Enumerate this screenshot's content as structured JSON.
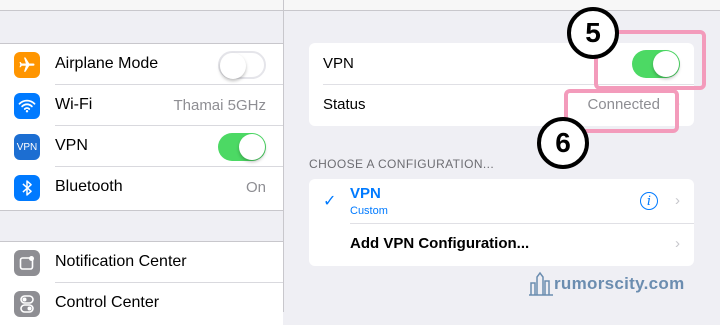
{
  "sidebar": {
    "items": [
      {
        "label": "Airplane Mode",
        "icon": "airplane-icon",
        "icon_color": "#ff9500",
        "control": "switch",
        "switch_on": false
      },
      {
        "label": "Wi-Fi",
        "icon": "wifi-icon",
        "icon_color": "#007aff",
        "value": "Thamai 5GHz"
      },
      {
        "label": "VPN",
        "icon": "vpn-icon",
        "icon_glyph": "VPN",
        "icon_color": "#1c6ed2",
        "control": "switch",
        "switch_on": true
      },
      {
        "label": "Bluetooth",
        "icon": "bluetooth-icon",
        "icon_color": "#007aff",
        "value": "On"
      }
    ],
    "items2": [
      {
        "label": "Notification Center",
        "icon": "notification-center-icon",
        "icon_color": "#8e8e93"
      },
      {
        "label": "Control Center",
        "icon": "control-center-icon",
        "icon_color": "#8e8e93"
      }
    ]
  },
  "vpn_panel": {
    "vpn_label": "VPN",
    "vpn_switch_on": true,
    "status_label": "Status",
    "status_value": "Connected",
    "section_header": "CHOOSE A CONFIGURATION...",
    "configs": [
      {
        "name": "VPN",
        "subtitle": "Custom",
        "checked": true
      },
      {
        "name": "Add VPN Configuration..."
      }
    ]
  },
  "annotations": {
    "badge_5": "5",
    "badge_6": "6",
    "highlight_color": "#f39bbb"
  },
  "watermark": {
    "text": "rumorscity.com"
  },
  "colors": {
    "accent": "#007aff",
    "switch_on": "#4cd964"
  }
}
